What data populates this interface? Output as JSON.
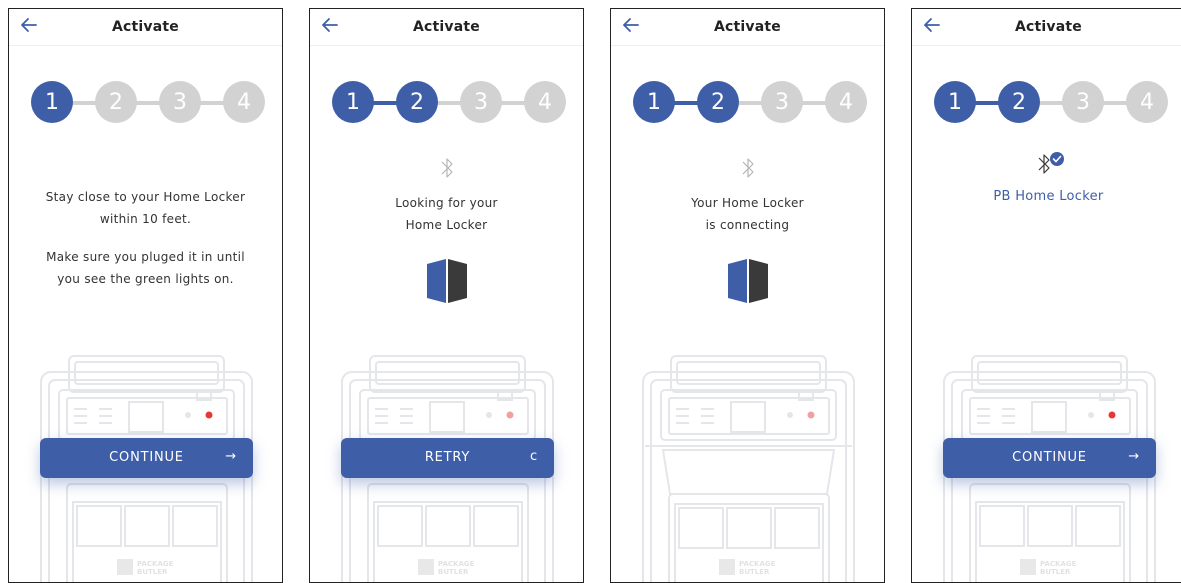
{
  "colors": {
    "accent": "#3e5ea8",
    "inactive_step": "#d2d2d2",
    "error_light": "#e53935"
  },
  "icons": {
    "back": "arrow-left-icon",
    "bluetooth": "bluetooth-icon",
    "bluetooth_connected": "bluetooth-check-icon",
    "continue": "arrow-right-icon",
    "retry": "refresh-icon",
    "logo": "package-butler-cube-icon"
  },
  "screens": [
    {
      "title": "Activate",
      "steps": [
        "1",
        "2",
        "3",
        "4"
      ],
      "active_steps": 1,
      "message_lines": [
        "Stay close to your Home Locker",
        "within 10 feet.",
        "Make sure you pluged it in until",
        "you see the green lights on."
      ],
      "button_label": "CONTINUE",
      "button_icon": "→"
    },
    {
      "title": "Activate",
      "steps": [
        "1",
        "2",
        "3",
        "4"
      ],
      "active_steps": 2,
      "message_lines": [
        "Looking for your",
        "Home Locker"
      ],
      "button_label": "RETRY",
      "button_icon": "c"
    },
    {
      "title": "Activate",
      "steps": [
        "1",
        "2",
        "3",
        "4"
      ],
      "active_steps": 2,
      "message_lines": [
        "Your Home Locker",
        "is connecting"
      ]
    },
    {
      "title": "Activate",
      "steps": [
        "1",
        "2",
        "3",
        "4"
      ],
      "active_steps": 2,
      "device_name": "PB Home Locker",
      "button_label": "CONTINUE",
      "button_icon": "→"
    }
  ]
}
